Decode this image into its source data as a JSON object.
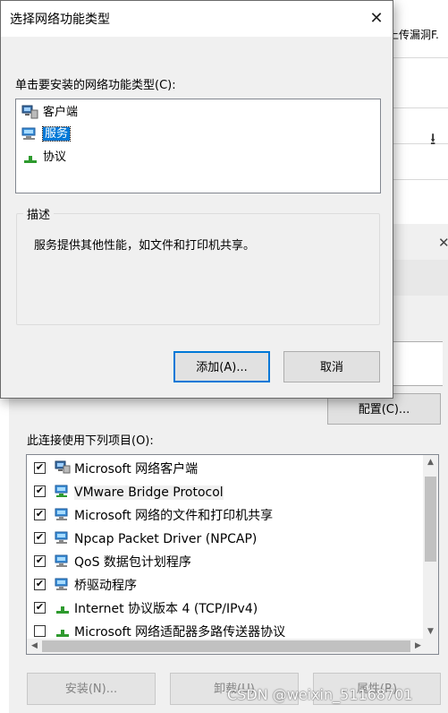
{
  "background_window": {
    "title_fragment": "上传漏洞F.",
    "configure_label": "配置(C)...",
    "items_label": "此连接使用下列项目(O):",
    "items": [
      {
        "label": "Microsoft 网络客户端",
        "checked": true,
        "icon": "client-icon"
      },
      {
        "label": "VMware Bridge Protocol",
        "checked": true,
        "icon": "protocol-icon"
      },
      {
        "label": "Microsoft 网络的文件和打印机共享",
        "checked": true,
        "icon": "service-icon"
      },
      {
        "label": "Npcap Packet Driver (NPCAP)",
        "checked": true,
        "icon": "service-icon"
      },
      {
        "label": "QoS 数据包计划程序",
        "checked": true,
        "icon": "service-icon"
      },
      {
        "label": "桥驱动程序",
        "checked": true,
        "icon": "service-icon"
      },
      {
        "label": "Internet 协议版本 4 (TCP/IPv4)",
        "checked": true,
        "icon": "protocol-icon"
      },
      {
        "label": "Microsoft 网络适配器多路传送器协议",
        "checked": false,
        "icon": "protocol-icon"
      }
    ],
    "install_label": "安装(N)...",
    "uninstall_label": "卸载(U)",
    "properties_label": "属性(R)"
  },
  "dialog": {
    "title": "选择网络功能类型",
    "prompt": "单击要安装的网络功能类型(C):",
    "types": [
      {
        "label": "客户端",
        "icon": "client-icon",
        "selected": false
      },
      {
        "label": "服务",
        "icon": "service-icon",
        "selected": true
      },
      {
        "label": "协议",
        "icon": "protocol-icon",
        "selected": false
      }
    ],
    "description_title": "描述",
    "description": "服务提供其他性能，如文件和打印机共享。",
    "add_label": "添加(A)...",
    "cancel_label": "取消"
  },
  "watermark": "CSDN @weixin_51168701",
  "colors": {
    "selection": "#0078d7",
    "dialog_bg": "#f0f0f0"
  }
}
